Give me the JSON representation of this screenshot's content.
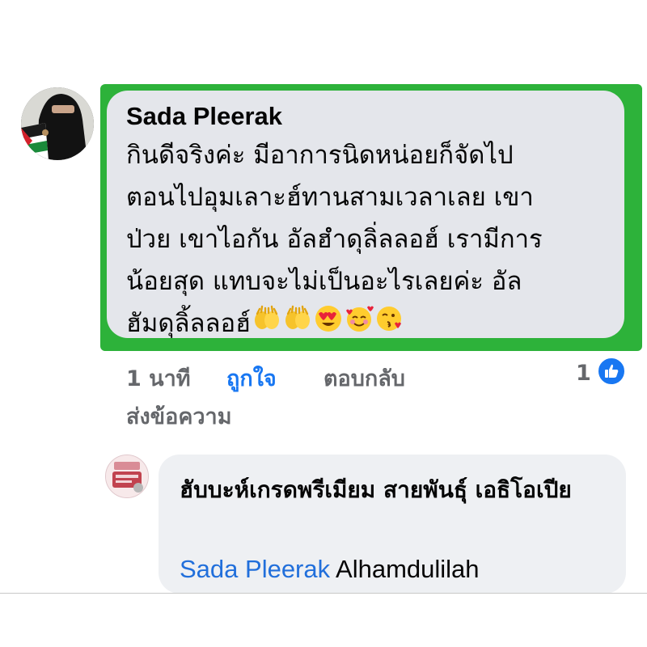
{
  "comment": {
    "author": "Sada Pleerak",
    "lines": [
      "กินดีจริงค่ะ  มีอาการนิดหน่อยก็จัดไป",
      "ตอนไปอุมเลาะฮ์ทานสามเวลาเลย  เขา",
      "ป่วย เขาไอกัน  อัลฮำดุลิ่ลลอฮ์  เรามีการ",
      "น้อยสุด แทบจะไม่เป็นอะไรเลยค่ะ  อัล",
      "ฮัมดุลิ้ลลอฮ์"
    ],
    "emojis": [
      "hands-icon",
      "hands-icon",
      "heart-eyes-icon",
      "smiling-hearts-icon",
      "kissing-heart-icon"
    ],
    "time": "1 นาที",
    "like_label": "ถูกใจ",
    "reply_label": "ตอบกลับ",
    "reaction_count": "1",
    "send_message_label": "ส่งข้อความ",
    "highlight_color": "#2db23a",
    "like_color": "#1877f2"
  },
  "reply": {
    "author": "ฮับบะห์เกรดพรีเมียม สายพันธุ์ เอธิโอเปีย",
    "mention": "Sada Pleerak",
    "text": "Alhamdulilah"
  }
}
